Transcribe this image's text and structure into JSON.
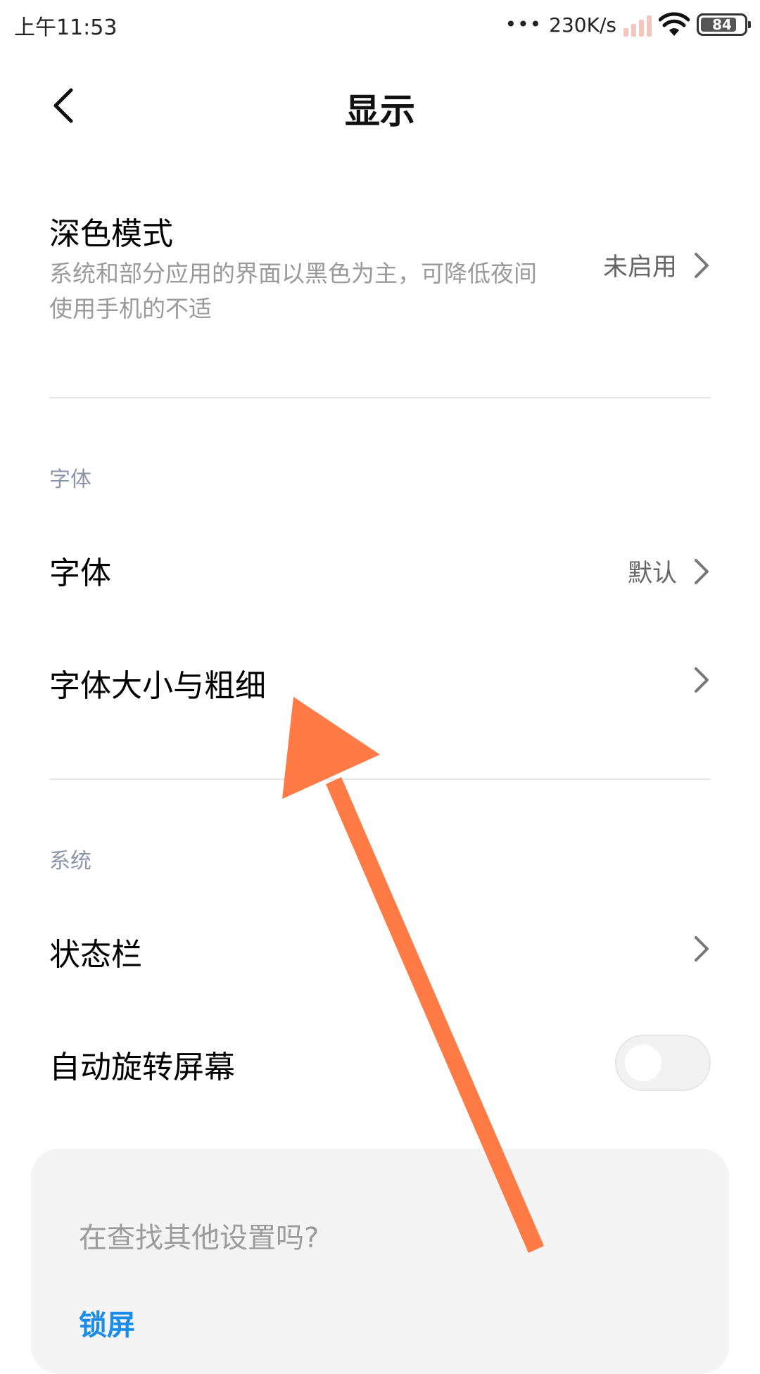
{
  "status_bar": {
    "time": "上午11:53",
    "dots": "•••",
    "net_speed": "230K/s",
    "battery_level": "84",
    "battery_fraction": 0.84,
    "wifi_icon": "wifi-icon",
    "signal_icon": "signal-icon"
  },
  "header": {
    "title": "显示",
    "back_icon": "chevron-left-icon"
  },
  "dark_mode": {
    "title": "深色模式",
    "description": "系统和部分应用的界面以黑色为主，可降低夜间使用手机的不适",
    "value": "未启用"
  },
  "font_section": {
    "header": "字体",
    "items": [
      {
        "label": "字体",
        "value": "默认"
      },
      {
        "label": "字体大小与粗细",
        "value": ""
      }
    ]
  },
  "system_section": {
    "header": "系统",
    "items": [
      {
        "label": "状态栏"
      },
      {
        "label": "自动旋转屏幕",
        "toggle_on": false
      }
    ]
  },
  "search_card": {
    "title": "在查找其他设置吗?",
    "link": "锁屏"
  },
  "colors": {
    "accent_link": "#1a8be6",
    "section_header": "#8d95a8",
    "annotation_arrow": "#ff7a45"
  }
}
